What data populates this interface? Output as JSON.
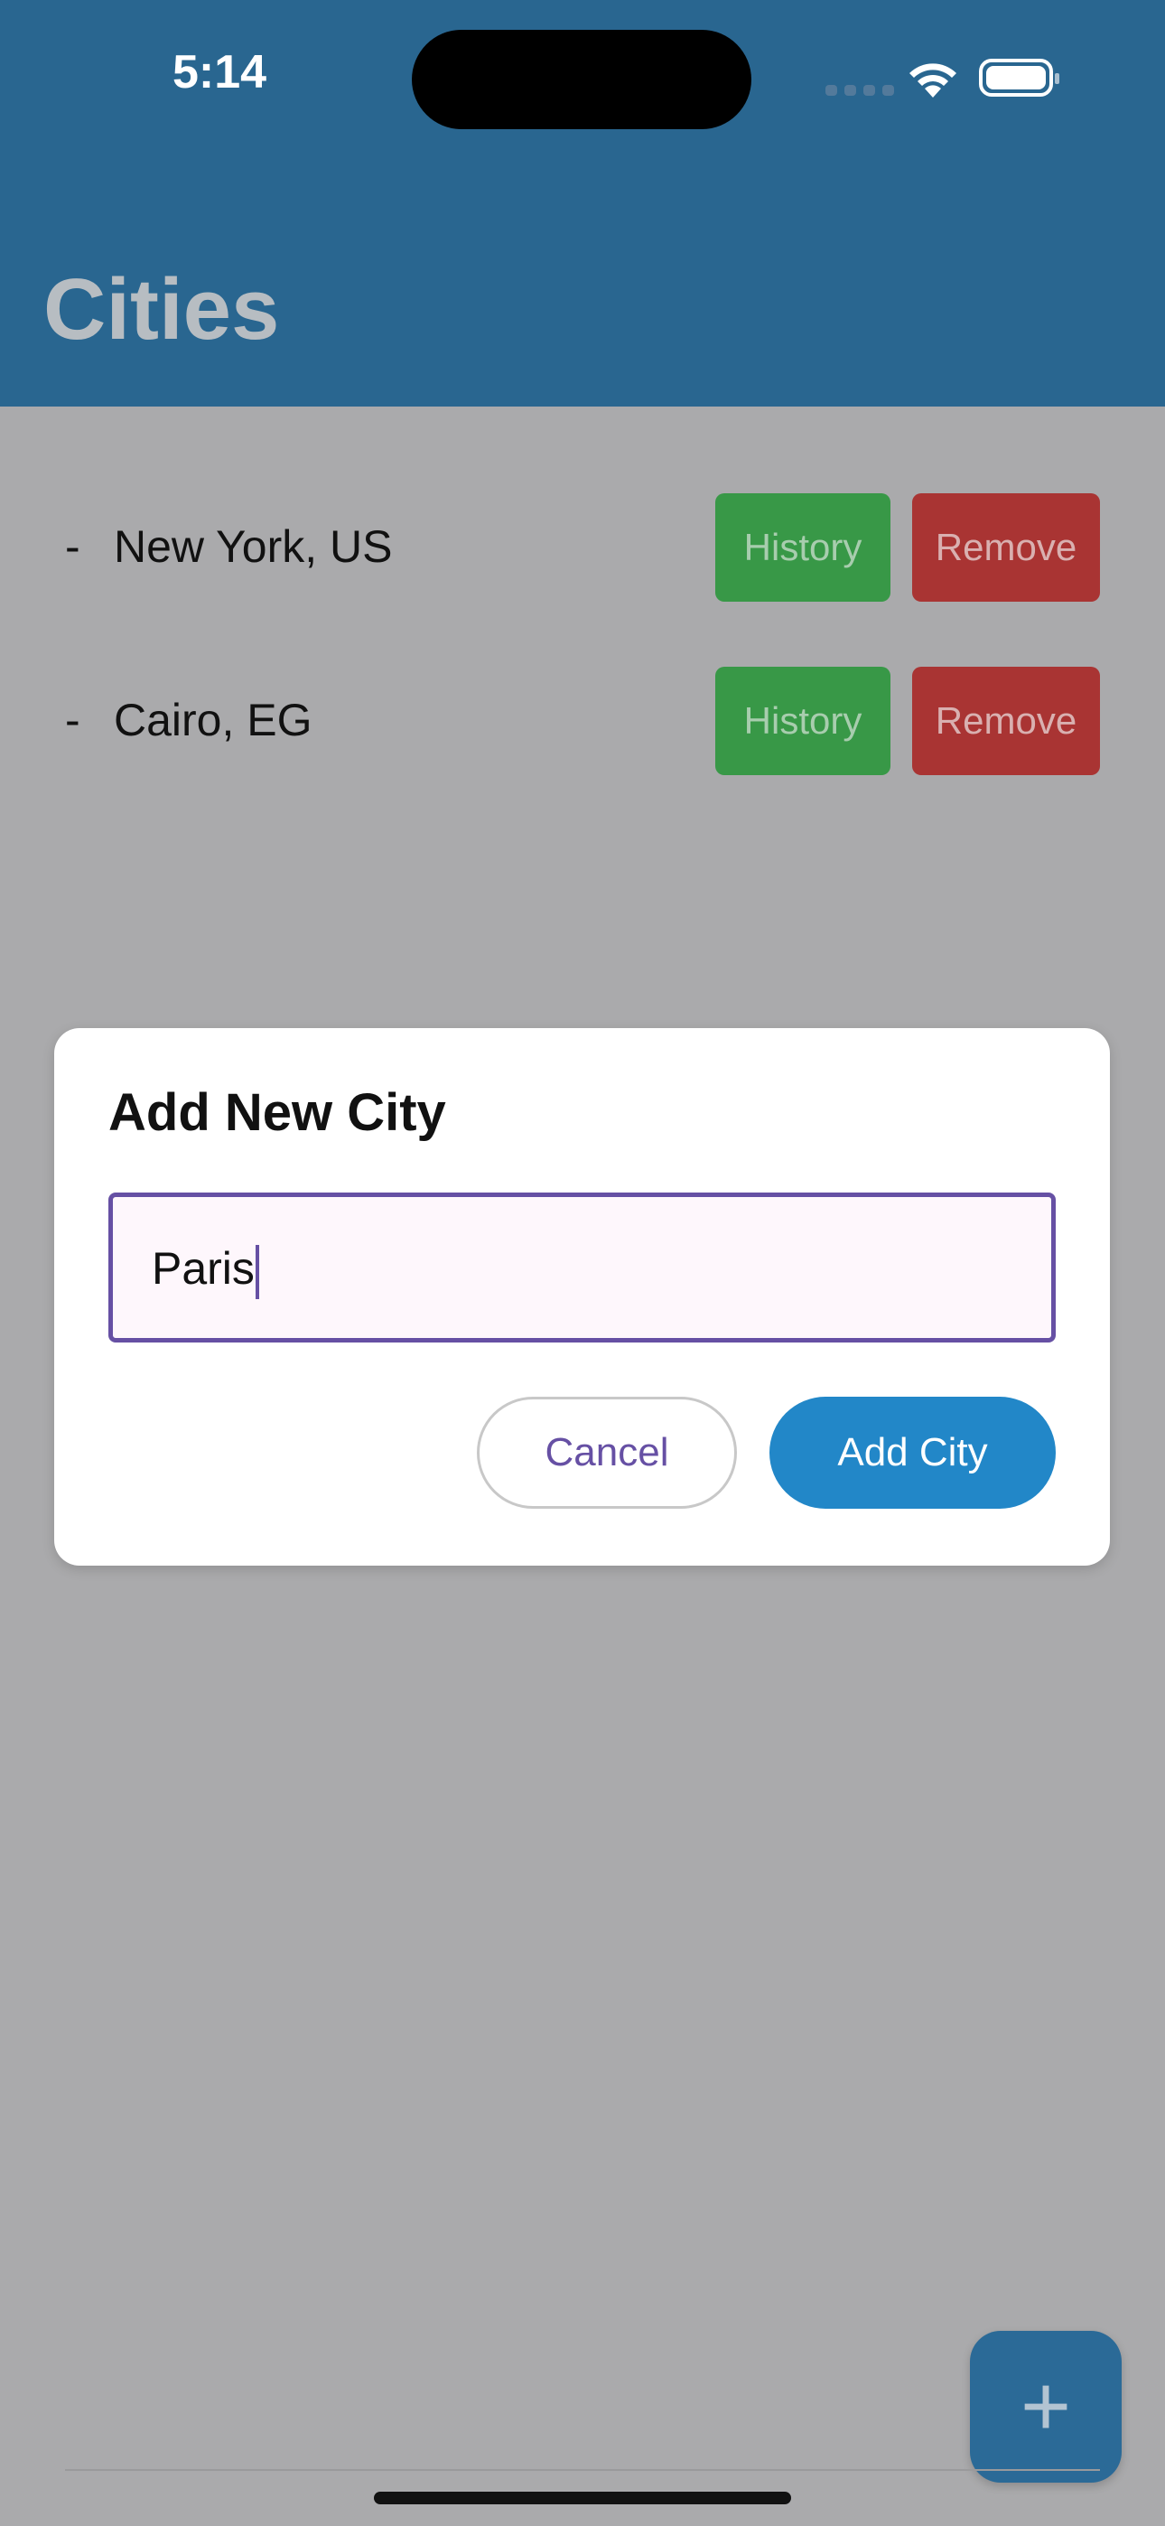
{
  "status_bar": {
    "time": "5:14"
  },
  "header": {
    "title": "Cities"
  },
  "cities": [
    {
      "dash": "-",
      "name": "New York, US",
      "history_label": "History",
      "remove_label": "Remove"
    },
    {
      "dash": "-",
      "name": "Cairo, EG",
      "history_label": "History",
      "remove_label": "Remove"
    }
  ],
  "dialog": {
    "title": "Add New City",
    "input_value": "Paris",
    "cancel_label": "Cancel",
    "add_label": "Add City"
  },
  "fab": {
    "label": "+"
  },
  "colors": {
    "header": "#296690",
    "history_button": "#389847",
    "remove_button": "#a93433",
    "add_button": "#2287c8",
    "accent": "#6650a4",
    "scrim": "#aaaaac"
  }
}
